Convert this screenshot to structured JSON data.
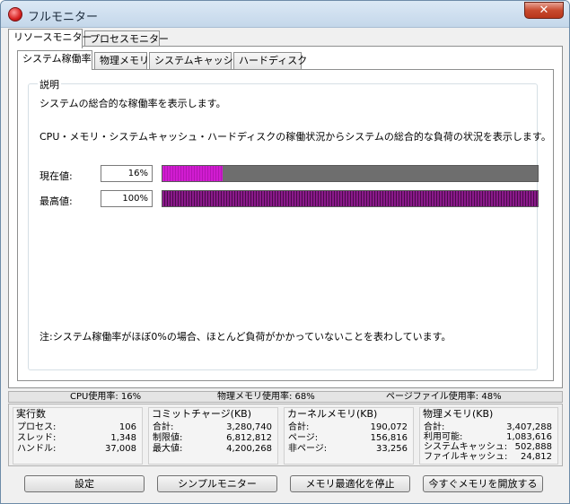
{
  "window": {
    "title": "フルモニター",
    "close_label": "✕"
  },
  "main_tabs": [
    {
      "label": "リソースモニター",
      "active": true
    },
    {
      "label": "プロセスモニター",
      "active": false
    }
  ],
  "sub_tabs": [
    {
      "label": "システム稼働率",
      "active": true
    },
    {
      "label": "物理メモリ",
      "active": false
    },
    {
      "label": "システムキャッシュ",
      "active": false
    },
    {
      "label": "ハードディスク",
      "active": false
    }
  ],
  "description": {
    "group_label": "説明",
    "line1": "システムの総合的な稼働率を表示します。",
    "line2": "CPU・メモリ・システムキャッシュ・ハードディスクの稼働状況からシステムの総合的な負荷の状況を表示します。",
    "note": "注:システム稼働率がほぼ0%の場合、ほとんど負荷がかかっていないことを表わしています。"
  },
  "meters": {
    "current": {
      "label": "現在値:",
      "value": "16%",
      "fraction": 0.16
    },
    "peak": {
      "label": "最高値:",
      "value": "100%",
      "fraction": 1.0
    }
  },
  "status": {
    "cpu": "CPU使用率: 16%",
    "physical_memory": "物理メモリ使用率: 68%",
    "page_file": "ページファイル使用率: 48%"
  },
  "stats": {
    "executing": {
      "title": "実行数",
      "rows": [
        {
          "k": "プロセス:",
          "v": "106"
        },
        {
          "k": "スレッド:",
          "v": "1,348"
        },
        {
          "k": "ハンドル:",
          "v": "37,008"
        }
      ]
    },
    "commit_charge": {
      "title": "コミットチャージ(KB)",
      "rows": [
        {
          "k": "合計:",
          "v": "3,280,740"
        },
        {
          "k": "制限値:",
          "v": "6,812,812"
        },
        {
          "k": "最大値:",
          "v": "4,200,268"
        }
      ]
    },
    "kernel_memory": {
      "title": "カーネルメモリ(KB)",
      "rows": [
        {
          "k": "合計:",
          "v": "190,072"
        },
        {
          "k": "ページ:",
          "v": "156,816"
        },
        {
          "k": "非ページ:",
          "v": "33,256"
        }
      ]
    },
    "physical_memory": {
      "title": "物理メモリ(KB)",
      "rows": [
        {
          "k": "合計:",
          "v": "3,407,288"
        },
        {
          "k": "利用可能:",
          "v": "1,083,616"
        },
        {
          "k": "システムキャッシュ:",
          "v": "502,888"
        },
        {
          "k": "ファイルキャッシュ:",
          "v": "24,812"
        }
      ]
    }
  },
  "buttons": {
    "settings": "設定",
    "simple_monitor": "シンプルモニター",
    "stop_optimize": "メモリ最適化を停止",
    "free_memory": "今すぐメモリを開放する"
  },
  "colors": {
    "current_bar": "#d11cd1",
    "peak_bar": "#8a1a8a",
    "bar_track": "#6e6e6e"
  }
}
